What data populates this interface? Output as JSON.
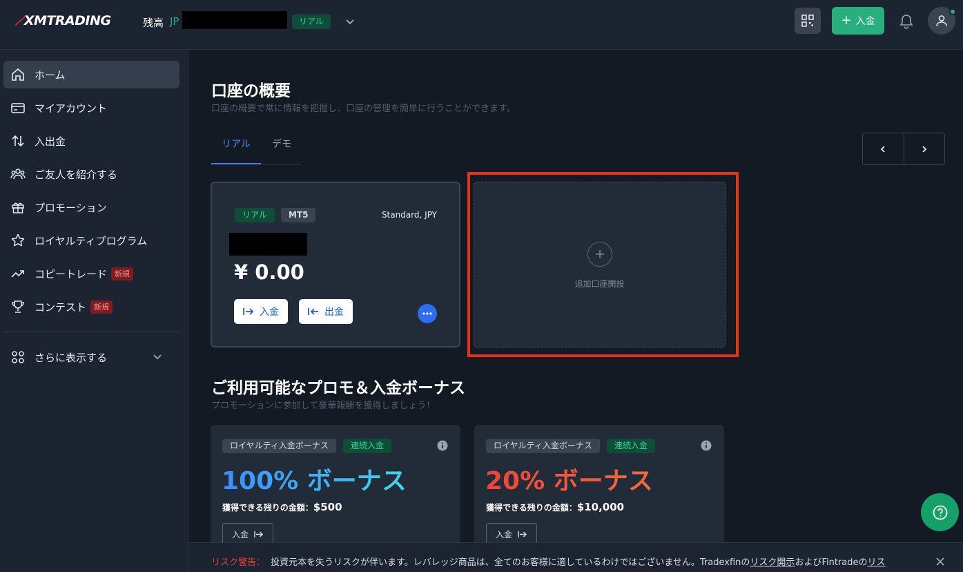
{
  "header": {
    "logo_text": "XMTRADING",
    "balance_label": "残高",
    "balance_currency": "JP",
    "account_badge": "リアル",
    "deposit_label": "入金"
  },
  "sidebar": {
    "items": [
      {
        "label": "ホーム",
        "icon": "home-icon"
      },
      {
        "label": "マイアカウント",
        "icon": "card-icon"
      },
      {
        "label": "入出金",
        "icon": "transfer-icon"
      },
      {
        "label": "ご友人を紹介する",
        "icon": "people-icon"
      },
      {
        "label": "プロモーション",
        "icon": "gift-icon"
      },
      {
        "label": "ロイヤルティプログラム",
        "icon": "star-icon"
      },
      {
        "label": "コピートレード",
        "icon": "trend-icon",
        "badge": "新規"
      },
      {
        "label": "コンテスト",
        "icon": "trophy-icon",
        "badge": "新規"
      }
    ],
    "more_label": "さらに表示する"
  },
  "overview": {
    "title": "口座の概要",
    "subtitle": "口座の概要で常に情報を把握し、口座の管理を簡単に行うことができます。",
    "tabs": [
      "リアル",
      "デモ"
    ]
  },
  "account_card": {
    "type_badge": "リアル",
    "platform_badge": "MT5",
    "account_type": "Standard, JPY",
    "balance": "¥ 0.00",
    "deposit_label": "入金",
    "withdraw_label": "出金"
  },
  "add_account": {
    "label": "追加口座開設"
  },
  "promotions": {
    "title": "ご利用可能なプロモ＆入金ボーナス",
    "subtitle": "プロモーションに参加して豪華報酬を獲得しましょう！",
    "cards": [
      {
        "tag": "ロイヤルティ入金ボーナス",
        "type": "連続入金",
        "bonus": "100% ボーナス",
        "remain_label": "獲得できる残りの金額：",
        "remain_amount": "$500",
        "button": "入金"
      },
      {
        "tag": "ロイヤルティ入金ボーナス",
        "type": "連続入金",
        "bonus": "20% ボーナス",
        "remain_label": "獲得できる残りの金額：",
        "remain_amount": "$10,000",
        "button": "入金"
      }
    ]
  },
  "risk": {
    "warning_label": "リスク警告：",
    "text": "投資元本を失うリスクが伴います。レバレッジ商品は、全てのお客様に適しているわけではございません。Tradexfinの",
    "link1": "リスク開示",
    "mid": "およびFintradeの",
    "link2": "リス"
  },
  "colors": {
    "accent_green": "#27b07e",
    "accent_blue": "#2f6df0",
    "highlight_red": "#e63312",
    "background": "#141a24"
  }
}
